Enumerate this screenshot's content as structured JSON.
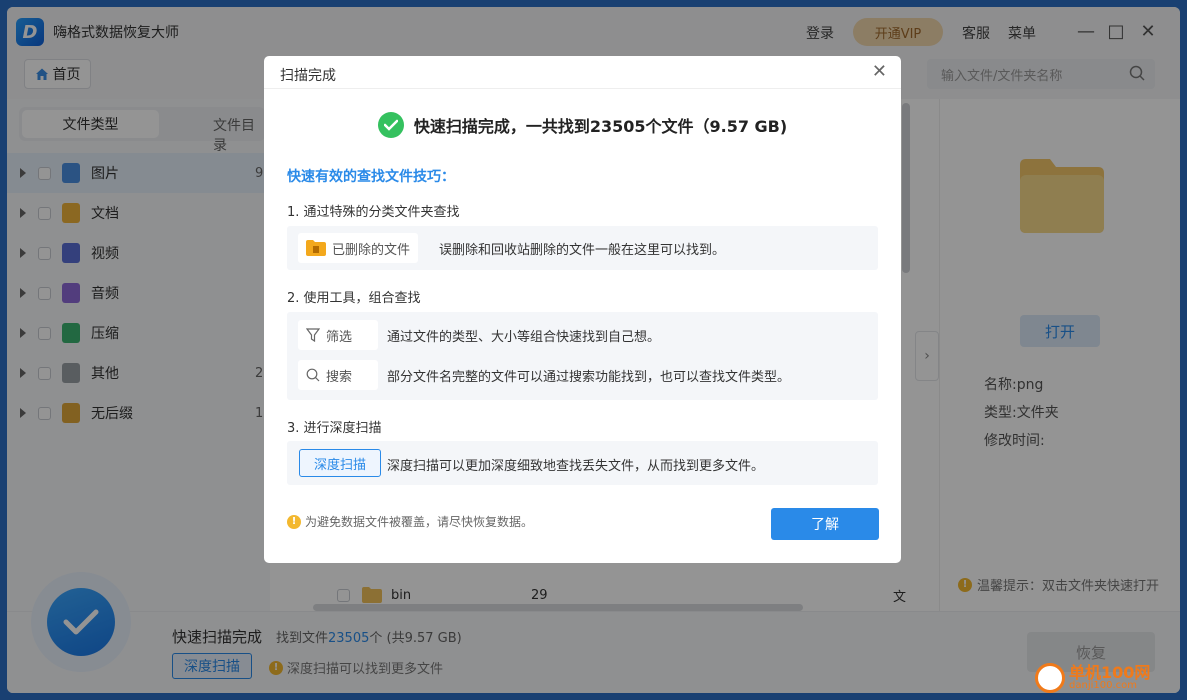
{
  "app": {
    "title": "嗨格式数据恢复大师",
    "logo_letter": "D",
    "login": "登录",
    "vip": "开通VIP",
    "service": "客服",
    "menu": "菜单"
  },
  "toolbar": {
    "home": "首页",
    "search_placeholder": "输入文件/文件夹名称"
  },
  "sidebar": {
    "tab_active": "文件类型",
    "tab_other": "文件目录",
    "items": [
      {
        "label": "图片",
        "count": "9",
        "icon": "image-icon",
        "color": "#4a90e2"
      },
      {
        "label": "文档",
        "count": "",
        "icon": "document-icon",
        "color": "#f0b43c"
      },
      {
        "label": "视频",
        "count": "",
        "icon": "video-icon",
        "color": "#5b6fd6"
      },
      {
        "label": "音频",
        "count": "",
        "icon": "audio-icon",
        "color": "#8e6ad8"
      },
      {
        "label": "压缩",
        "count": "",
        "icon": "archive-icon",
        "color": "#3cb371"
      },
      {
        "label": "其他",
        "count": "2",
        "icon": "other-icon",
        "color": "#9aa0a6"
      },
      {
        "label": "无后缀",
        "count": "1",
        "icon": "no-ext-icon",
        "color": "#e0a83a"
      }
    ]
  },
  "file_list": {
    "row": {
      "name": "bin",
      "count": "29",
      "type": "文"
    }
  },
  "right_panel": {
    "open": "打开",
    "name": "名称:png",
    "type": "类型:文件夹",
    "modified": "修改时间:",
    "tip": "温馨提示：双击文件夹快速打开"
  },
  "bottom": {
    "title": "快速扫描完成",
    "found_prefix": "找到文件",
    "found_count": "23505",
    "found_suffix": "个  (共9.57 GB)",
    "deep_scan": "深度扫描",
    "tip": "深度扫描可以找到更多文件",
    "recover": "恢复"
  },
  "dialog": {
    "title": "扫描完成",
    "headline": "快速扫描完成，一共找到23505个文件（9.57 GB)",
    "subhead": "快速有效的查找文件技巧：",
    "step1": "1. 通过特殊的分类文件夹查找",
    "step1_chip": "已删除的文件",
    "step1_text": "误删除和回收站删除的文件一般在这里可以找到。",
    "step2": "2. 使用工具，组合查找",
    "step2_chip_filter": "筛选",
    "step2_filter_text": "通过文件的类型、大小等组合快速找到自己想。",
    "step2_chip_search": "搜索",
    "step2_search_text": "部分文件名完整的文件可以通过搜索功能找到，也可以查找文件类型。",
    "step3": "3. 进行深度扫描",
    "step3_chip": "深度扫描",
    "step3_text": "深度扫描可以更加深度细致地查找丢失文件，从而找到更多文件。",
    "footer_tip": "为避免数据文件被覆盖，请尽快恢复数据。",
    "ok": "了解"
  },
  "watermark": {
    "big": "单机100网",
    "small": "danji100.com"
  }
}
